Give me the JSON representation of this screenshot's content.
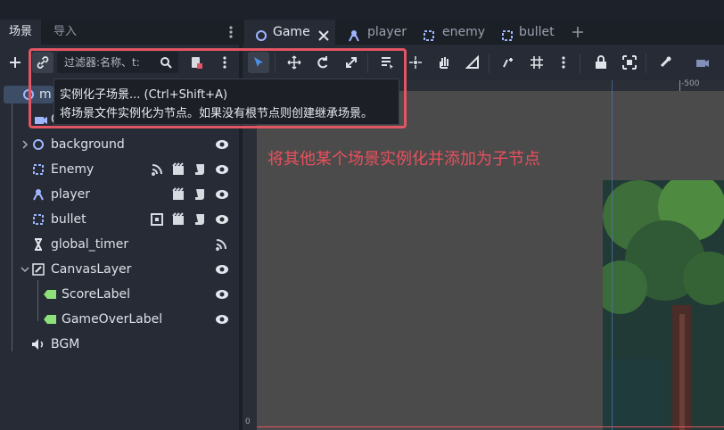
{
  "dock": {
    "tabs": [
      "场景",
      "导入"
    ],
    "filter_placeholder": "过滤器:名称、t:",
    "tree": [
      {
        "label": "m",
        "icon": "node2d-icon"
      },
      {
        "label": "Camera2D",
        "icon": "camera-icon"
      },
      {
        "label": "background",
        "icon": "circle-node-icon"
      },
      {
        "label": "Enemy",
        "icon": "area-node-icon"
      },
      {
        "label": "player",
        "icon": "player-node-icon"
      },
      {
        "label": "bullet",
        "icon": "area-node-icon"
      },
      {
        "label": "global_timer",
        "icon": "timer-icon"
      },
      {
        "label": "CanvasLayer",
        "icon": "canvas-layer-icon"
      },
      {
        "label": "ScoreLabel",
        "icon": "label-icon"
      },
      {
        "label": "GameOverLabel",
        "icon": "label-icon"
      },
      {
        "label": "BGM",
        "icon": "speaker-icon"
      }
    ]
  },
  "scene_tabs": [
    {
      "label": "Game",
      "icon": "circle-node-icon",
      "active": true
    },
    {
      "label": "player",
      "icon": "player-node-icon",
      "active": false
    },
    {
      "label": "enemy",
      "icon": "area-node-icon",
      "active": false
    },
    {
      "label": "bullet",
      "icon": "area-node-icon",
      "active": false
    }
  ],
  "tooltip": {
    "line1": "实例化子场景... (Ctrl+Shift+A)",
    "line2": "将场景文件实例化为节点。如果没有根节点则创建继承场景。"
  },
  "annotation": "将其他某个场景实例化并添加为子节点",
  "ruler": {
    "top_label": "-500",
    "left_label": "0"
  },
  "colors": {
    "accent": "#4a8fe8",
    "highlight": "#e25563",
    "annotation": "#e9505d"
  }
}
